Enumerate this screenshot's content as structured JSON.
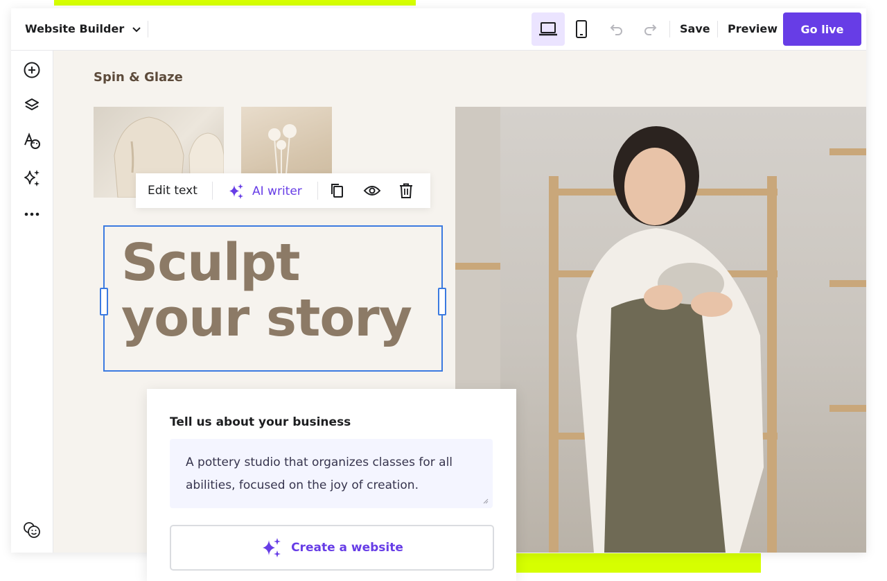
{
  "topbar": {
    "builder_label": "Website Builder",
    "save_label": "Save",
    "preview_label": "Preview",
    "golive_label": "Go live"
  },
  "sidebar": {
    "icons": [
      "add-icon",
      "layers-icon",
      "styles-icon",
      "ai-sparkle-icon",
      "more-icon",
      "emoji-icon"
    ]
  },
  "canvas": {
    "brand": "Spin & Glaze",
    "heading_line1": "Sculpt",
    "heading_line2": "your story"
  },
  "floating_toolbar": {
    "edit_text": "Edit text",
    "ai_writer": "AI writer"
  },
  "prompt_card": {
    "title": "Tell us about your business",
    "textarea_value": "A pottery studio that organizes classes for all abilities, focused on the joy of creation.",
    "create_button": "Create a website"
  },
  "colors": {
    "accent": "#673de6",
    "lime": "#d6ff00",
    "canvas_bg": "#f6f3ee",
    "heading": "#8c7a66",
    "selection": "#3b7ae0"
  }
}
